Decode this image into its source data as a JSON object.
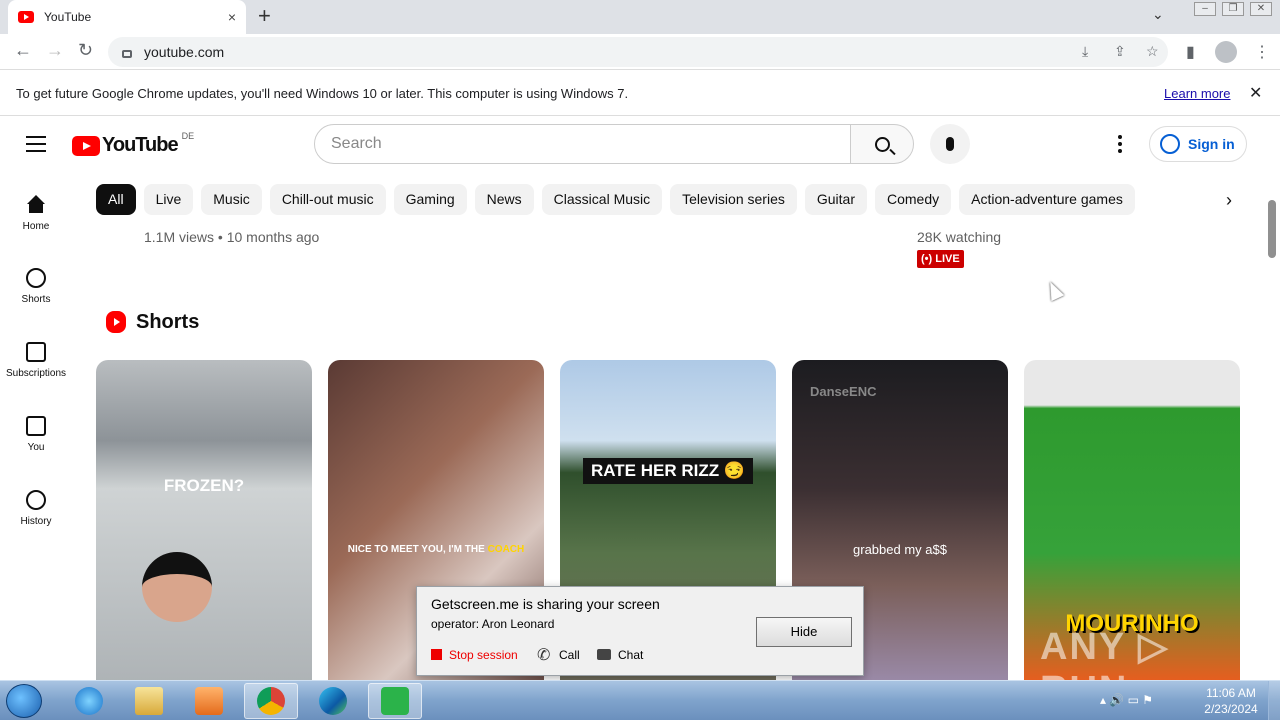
{
  "browser": {
    "tab_title": "YouTube",
    "tab_close": "×",
    "new_tab": "+",
    "tab_search": "⌄",
    "url": "youtube.com",
    "nav_back": "←",
    "nav_forward": "→",
    "nav_reload": "↻",
    "window_minimize": "–",
    "window_restore": "❐",
    "window_close": "✕"
  },
  "infobar": {
    "message": "To get future Google Chrome updates, you'll need Windows 10 or later. This computer is using Windows 7.",
    "link": "Learn more",
    "close": "✕"
  },
  "youtube": {
    "logo_text": "YouTube",
    "country_code": "DE",
    "search_placeholder": "Search",
    "sign_in": "Sign in",
    "chips": [
      "All",
      "Live",
      "Music",
      "Chill-out music",
      "Gaming",
      "News",
      "Classical Music",
      "Television series",
      "Guitar",
      "Comedy",
      "Action-adventure games"
    ],
    "chips_next": "›",
    "guide": [
      {
        "label": "Home",
        "icon": "home-icon"
      },
      {
        "label": "Shorts",
        "icon": "shorts-icon"
      },
      {
        "label": "Subscriptions",
        "icon": "subscriptions-icon"
      },
      {
        "label": "You",
        "icon": "you-icon"
      },
      {
        "label": "History",
        "icon": "history-icon"
      }
    ],
    "feed": {
      "video_meta": "1.1M views • 10 months ago",
      "live_watching": "28K watching",
      "live_badge": "LIVE",
      "live_badge_icon": "(•)"
    },
    "shorts_section": {
      "title": "Shorts",
      "items": [
        {
          "caption": "FROZEN?"
        },
        {
          "caption_pre": "NICE TO MEET YOU, I'M THE ",
          "caption_hl": "COACH"
        },
        {
          "caption": "RATE HER RIZZ 😏"
        },
        {
          "caption": "grabbed my a$$",
          "watermark": "DanseENC"
        },
        {
          "caption": "MOURINHO"
        }
      ]
    }
  },
  "screenshare_dialog": {
    "title": "Getscreen.me is sharing your screen",
    "operator": "operator: Aron Leonard",
    "hide": "Hide",
    "stop": "Stop session",
    "call": "Call",
    "chat": "Chat"
  },
  "taskbar": {
    "time": "11:06 AM",
    "date": "2/23/2024",
    "apps": [
      "internet-explorer",
      "file-explorer",
      "media-player",
      "chrome",
      "edge",
      "getscreen"
    ]
  },
  "overlay_watermark": "ANY ▷ RUN",
  "colors": {
    "yt_red": "#ff0000",
    "link_blue": "#065fd4",
    "chip_active": "#0f0f0f",
    "live_red": "#cc0000"
  }
}
